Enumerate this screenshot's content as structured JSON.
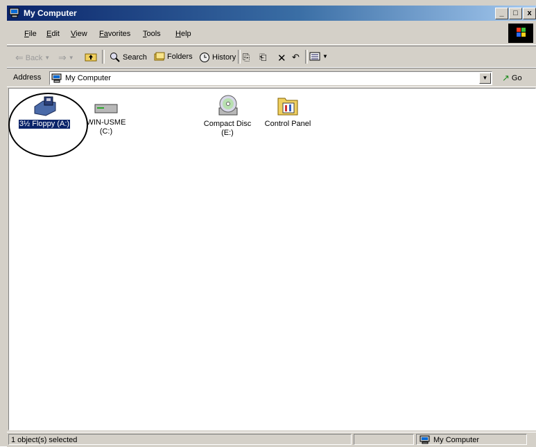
{
  "window": {
    "title": "My Computer",
    "min": "_",
    "max": "□",
    "close": "x"
  },
  "menu": [
    {
      "u": "F",
      "rest": "ile"
    },
    {
      "u": "E",
      "rest": "dit"
    },
    {
      "u": "V",
      "rest": "iew"
    },
    {
      "u": "Fa",
      "rest": "vorites"
    },
    {
      "u": "T",
      "rest": "ools"
    },
    {
      "u": "H",
      "rest": "elp"
    }
  ],
  "toolbar": {
    "back": "Back",
    "search": "Search",
    "folders": "Folders",
    "history": "History"
  },
  "address": {
    "label": "Address",
    "value": "My Computer",
    "go": "Go"
  },
  "drives": [
    {
      "line1": "3½ Floppy (A:)",
      "line2": ""
    },
    {
      "line1": "WIN-USME",
      "line2": "(C:)"
    },
    {
      "line1": "Compact Disc",
      "line2": "(E:)"
    },
    {
      "line1": "Control Panel",
      "line2": ""
    }
  ],
  "status": {
    "left": "1 object(s) selected",
    "right": "My Computer"
  }
}
